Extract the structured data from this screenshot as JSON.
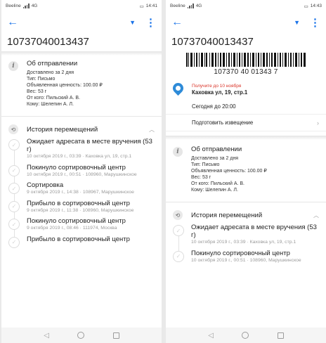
{
  "left": {
    "status": {
      "carrier": "Beeline",
      "net": "4G",
      "time": "14:41"
    },
    "track_number": "10737040013437",
    "about": {
      "title": "Об отправлении",
      "lines": [
        "Доставлено за 2 дня",
        "Тип: Письмо",
        "Объявленная ценность: 100.00 ₽",
        "Вес: 53 г",
        "От кого: Пильский А. В.",
        "Кому: Шелепин А. Л."
      ]
    },
    "history": {
      "title": "История перемещений",
      "events": [
        {
          "title": "Ожидает адресата в месте вручения (53 г)",
          "meta": "10 октября 2019 г., 03:39 · Каховка ул, 19, стр.1"
        },
        {
          "title": "Покинуло сортировочный центр",
          "meta": "10 октября 2019 г., 00:51 · 108960, Марушкинское"
        },
        {
          "title": "Сортировка",
          "meta": "9 октября 2019 г., 14:38 · 108967, Марушкинское"
        },
        {
          "title": "Прибыло в сортировочный центр",
          "meta": "9 октября 2019 г., 11:38 · 108960, Марушкинское"
        },
        {
          "title": "Покинуло сортировочный центр",
          "meta": "9 октября 2019 г., 08:46 · 111974, Москва"
        },
        {
          "title": "Прибыло в сортировочный центр",
          "meta": ""
        }
      ]
    }
  },
  "right": {
    "status": {
      "carrier": "Beeline",
      "net": "4G",
      "time": "14:43"
    },
    "track_number": "10737040013437",
    "barcode_text": "107370 40 01343 7",
    "pickup": {
      "deadline": "Получите до 10 ноября",
      "address": "Каховка ул, 19, стр.1"
    },
    "today": "Сегодня до 20:00",
    "notice": "Подготовить извещение",
    "about": {
      "title": "Об отправлении",
      "lines": [
        "Доставлено за 2 дня",
        "Тип: Письмо",
        "Объявленная ценность: 100.00 ₽",
        "Вес: 53 г",
        "От кого: Пильский А. В.",
        "Кому: Шелепин А. Л."
      ]
    },
    "history": {
      "title": "История перемещений",
      "events": [
        {
          "title": "Ожидает адресата в месте вручения (53 г)",
          "meta": "10 октября 2019 г., 03:39 · Каховка ул, 19, стр.1"
        },
        {
          "title": "Покинуло сортировочный центр",
          "meta": "10 октября 2019 г., 00:51 · 108960, Марушкинское"
        }
      ]
    }
  },
  "colors": {
    "accent": "#1a73e8",
    "deadline": "#d93025",
    "pin": "#2e8bd8"
  }
}
